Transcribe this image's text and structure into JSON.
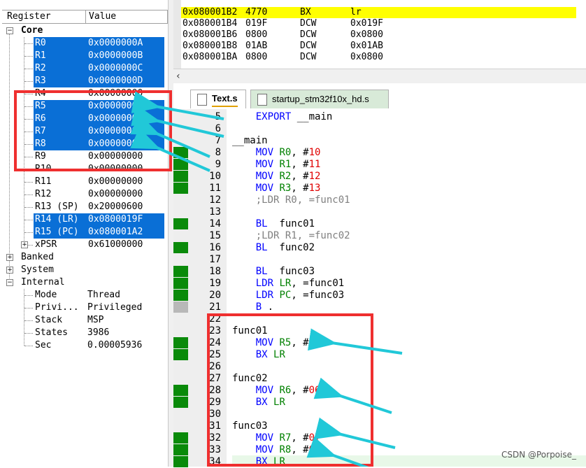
{
  "registers_pane": {
    "header": {
      "col_register": "Register",
      "col_value": "Value"
    },
    "groups": {
      "core": "Core",
      "banked": "Banked",
      "system": "System",
      "internal": "Internal"
    },
    "core_rows": [
      {
        "name": "R0",
        "value": "0x0000000A",
        "selected": true
      },
      {
        "name": "R1",
        "value": "0x0000000B",
        "selected": true
      },
      {
        "name": "R2",
        "value": "0x0000000C",
        "selected": true
      },
      {
        "name": "R3",
        "value": "0x0000000D",
        "selected": true
      },
      {
        "name": "R4",
        "value": "0x00000000",
        "selected": false
      },
      {
        "name": "R5",
        "value": "0x00000005",
        "selected": true
      },
      {
        "name": "R6",
        "value": "0x00000006",
        "selected": true
      },
      {
        "name": "R7",
        "value": "0x00000007",
        "selected": true
      },
      {
        "name": "R8",
        "value": "0x00000008",
        "selected": true
      },
      {
        "name": "R9",
        "value": "0x00000000",
        "selected": false
      },
      {
        "name": "R10",
        "value": "0x00000000",
        "selected": false
      },
      {
        "name": "R11",
        "value": "0x00000000",
        "selected": false
      },
      {
        "name": "R12",
        "value": "0x00000000",
        "selected": false
      },
      {
        "name": "R13 (SP)",
        "value": "0x20000600",
        "selected": false
      },
      {
        "name": "R14 (LR)",
        "value": "0x0800019F",
        "selected": true
      },
      {
        "name": "R15 (PC)",
        "value": "0x080001A2",
        "selected": true
      },
      {
        "name": "xPSR",
        "value": "0x61000000",
        "selected": false
      }
    ],
    "internal_rows": [
      {
        "name": "Mode",
        "value": "Thread"
      },
      {
        "name": "Privi...",
        "value": "Privileged"
      },
      {
        "name": "Stack",
        "value": "MSP"
      },
      {
        "name": "States",
        "value": "3986"
      },
      {
        "name": "Sec",
        "value": "0.00005936"
      }
    ]
  },
  "disassembly": {
    "rows": [
      {
        "addr": "0x080001B2",
        "hex": "4770",
        "mnem": "BX",
        "op": "lr",
        "current": true
      },
      {
        "addr": "0x080001B4",
        "hex": "019F",
        "mnem": "DCW",
        "op": "0x019F",
        "current": false
      },
      {
        "addr": "0x080001B6",
        "hex": "0800",
        "mnem": "DCW",
        "op": "0x0800",
        "current": false
      },
      {
        "addr": "0x080001B8",
        "hex": "01AB",
        "mnem": "DCW",
        "op": "0x01AB",
        "current": false
      },
      {
        "addr": "0x080001BA",
        "hex": "0800",
        "mnem": "DCW",
        "op": "0x0800",
        "current": false
      }
    ]
  },
  "tabs": [
    {
      "label": "Text.s",
      "active": true
    },
    {
      "label": "startup_stm32f10x_hd.s",
      "active": false
    }
  ],
  "editor": {
    "lines": [
      {
        "no": "5",
        "segs": [
          {
            "t": "    "
          },
          {
            "t": "EXPORT",
            "c": "kw"
          },
          {
            "t": " __main"
          }
        ],
        "mark": ""
      },
      {
        "no": "6",
        "segs": [],
        "mark": ""
      },
      {
        "no": "7",
        "segs": [
          {
            "t": "__main"
          }
        ],
        "mark": ""
      },
      {
        "no": "8",
        "segs": [
          {
            "t": "    "
          },
          {
            "t": "MOV",
            "c": "kw"
          },
          {
            "t": " "
          },
          {
            "t": "R0",
            "c": "reg"
          },
          {
            "t": ", #"
          },
          {
            "t": "10",
            "c": "num"
          }
        ],
        "mark": "green"
      },
      {
        "no": "9",
        "segs": [
          {
            "t": "    "
          },
          {
            "t": "MOV",
            "c": "kw"
          },
          {
            "t": " "
          },
          {
            "t": "R1",
            "c": "reg"
          },
          {
            "t": ", #"
          },
          {
            "t": "11",
            "c": "num"
          }
        ],
        "mark": "green"
      },
      {
        "no": "10",
        "segs": [
          {
            "t": "    "
          },
          {
            "t": "MOV",
            "c": "kw"
          },
          {
            "t": " "
          },
          {
            "t": "R2",
            "c": "reg"
          },
          {
            "t": ", #"
          },
          {
            "t": "12",
            "c": "num"
          }
        ],
        "mark": "green"
      },
      {
        "no": "11",
        "segs": [
          {
            "t": "    "
          },
          {
            "t": "MOV",
            "c": "kw"
          },
          {
            "t": " "
          },
          {
            "t": "R3",
            "c": "reg"
          },
          {
            "t": ", #"
          },
          {
            "t": "13",
            "c": "num"
          }
        ],
        "mark": "green"
      },
      {
        "no": "12",
        "segs": [
          {
            "t": "    "
          },
          {
            "t": ";LDR R0, =func01",
            "c": "cmt"
          }
        ],
        "mark": ""
      },
      {
        "no": "13",
        "segs": [],
        "mark": ""
      },
      {
        "no": "14",
        "segs": [
          {
            "t": "    "
          },
          {
            "t": "BL",
            "c": "kw"
          },
          {
            "t": "  func01"
          }
        ],
        "mark": "green"
      },
      {
        "no": "15",
        "segs": [
          {
            "t": "    "
          },
          {
            "t": ";LDR R1, =func02",
            "c": "cmt"
          }
        ],
        "mark": ""
      },
      {
        "no": "16",
        "segs": [
          {
            "t": "    "
          },
          {
            "t": "BL",
            "c": "kw"
          },
          {
            "t": "  func02"
          }
        ],
        "mark": "green"
      },
      {
        "no": "17",
        "segs": [],
        "mark": ""
      },
      {
        "no": "18",
        "segs": [
          {
            "t": "    "
          },
          {
            "t": "BL",
            "c": "kw"
          },
          {
            "t": "  func03"
          }
        ],
        "mark": "green"
      },
      {
        "no": "19",
        "segs": [
          {
            "t": "    "
          },
          {
            "t": "LDR",
            "c": "kw"
          },
          {
            "t": " "
          },
          {
            "t": "LR",
            "c": "reg"
          },
          {
            "t": ", =func01"
          }
        ],
        "mark": "green"
      },
      {
        "no": "20",
        "segs": [
          {
            "t": "    "
          },
          {
            "t": "LDR",
            "c": "kw"
          },
          {
            "t": " "
          },
          {
            "t": "PC",
            "c": "reg"
          },
          {
            "t": ", =func03"
          }
        ],
        "mark": "green"
      },
      {
        "no": "21",
        "segs": [
          {
            "t": "    "
          },
          {
            "t": "B",
            "c": "kw"
          },
          {
            "t": " ."
          }
        ],
        "mark": "gray"
      },
      {
        "no": "22",
        "segs": [],
        "mark": ""
      },
      {
        "no": "23",
        "segs": [
          {
            "t": "func01"
          }
        ],
        "mark": ""
      },
      {
        "no": "24",
        "segs": [
          {
            "t": "    "
          },
          {
            "t": "MOV",
            "c": "kw"
          },
          {
            "t": " "
          },
          {
            "t": "R5",
            "c": "reg"
          },
          {
            "t": ", #"
          },
          {
            "t": "05",
            "c": "num"
          }
        ],
        "mark": "green"
      },
      {
        "no": "25",
        "segs": [
          {
            "t": "    "
          },
          {
            "t": "BX",
            "c": "kw"
          },
          {
            "t": " "
          },
          {
            "t": "LR",
            "c": "reg"
          }
        ],
        "mark": "green"
      },
      {
        "no": "26",
        "segs": [],
        "mark": ""
      },
      {
        "no": "27",
        "segs": [
          {
            "t": "func02"
          }
        ],
        "mark": ""
      },
      {
        "no": "28",
        "segs": [
          {
            "t": "    "
          },
          {
            "t": "MOV",
            "c": "kw"
          },
          {
            "t": " "
          },
          {
            "t": "R6",
            "c": "reg"
          },
          {
            "t": ", #"
          },
          {
            "t": "06",
            "c": "num"
          }
        ],
        "mark": "green"
      },
      {
        "no": "29",
        "segs": [
          {
            "t": "    "
          },
          {
            "t": "BX",
            "c": "kw"
          },
          {
            "t": " "
          },
          {
            "t": "LR",
            "c": "reg"
          }
        ],
        "mark": "green"
      },
      {
        "no": "30",
        "segs": [],
        "mark": ""
      },
      {
        "no": "31",
        "segs": [
          {
            "t": "func03"
          }
        ],
        "mark": ""
      },
      {
        "no": "32",
        "segs": [
          {
            "t": "    "
          },
          {
            "t": "MOV",
            "c": "kw"
          },
          {
            "t": " "
          },
          {
            "t": "R7",
            "c": "reg"
          },
          {
            "t": ", #"
          },
          {
            "t": "07",
            "c": "num"
          }
        ],
        "mark": "green"
      },
      {
        "no": "33",
        "segs": [
          {
            "t": "    "
          },
          {
            "t": "MOV",
            "c": "kw"
          },
          {
            "t": " "
          },
          {
            "t": "R8",
            "c": "reg"
          },
          {
            "t": ", #"
          },
          {
            "t": "08",
            "c": "num"
          }
        ],
        "mark": "green"
      },
      {
        "no": "34",
        "segs": [
          {
            "t": "    "
          },
          {
            "t": "BX",
            "c": "kw"
          },
          {
            "t": " "
          },
          {
            "t": "LR",
            "c": "reg"
          }
        ],
        "mark": "green"
      }
    ]
  },
  "watermark": "CSDN @Porpoise_",
  "colors": {
    "selection": "#0a6fd6",
    "current_line": "#ffff00",
    "annotation_red": "#ef2f2f",
    "annotation_arrow": "#21c8d8",
    "exec_mark": "#0a8a0a"
  }
}
